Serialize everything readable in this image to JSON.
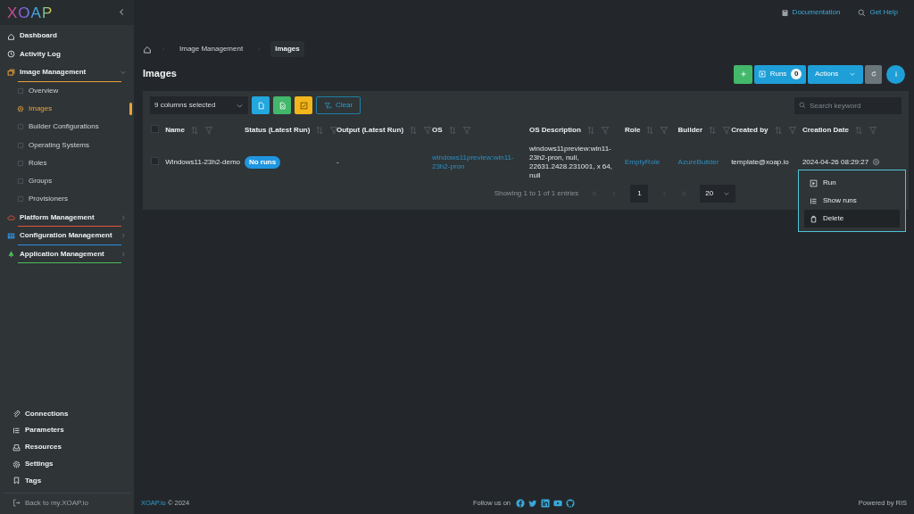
{
  "logo": "XOAP",
  "sidebar": {
    "items": [
      {
        "label": "Dashboard",
        "kind": "link"
      },
      {
        "label": "Activity Log",
        "kind": "link"
      },
      {
        "label": "Image Management",
        "kind": "group",
        "color": "#e8a33c",
        "expanded": true,
        "children": [
          {
            "label": "Overview",
            "selected": false
          },
          {
            "label": "Images",
            "selected": true
          },
          {
            "label": "Builder Configurations",
            "selected": false
          },
          {
            "label": "Operating Systems",
            "selected": false
          },
          {
            "label": "Roles",
            "selected": false
          },
          {
            "label": "Groups",
            "selected": false
          },
          {
            "label": "Provisioners",
            "selected": false
          }
        ]
      },
      {
        "label": "Platform Management",
        "kind": "group",
        "color": "#e0553b",
        "expanded": false
      },
      {
        "label": "Configuration Management",
        "kind": "group",
        "color": "#2f8fe0",
        "expanded": false
      },
      {
        "label": "Application Management",
        "kind": "group",
        "color": "#4cbb5a",
        "expanded": false
      }
    ],
    "bottom_items": [
      "Connections",
      "Parameters",
      "Resources",
      "Settings",
      "Tags"
    ],
    "back_link": "Back to my.XOAP.io"
  },
  "header_links": [
    "Documentation",
    "Get Help"
  ],
  "breadcrumb": [
    {
      "label": "Image Management",
      "selected": false
    },
    {
      "label": "Images",
      "selected": true
    }
  ],
  "page_title": "Images",
  "toolbar": {
    "runs_label": "Runs",
    "runs_count": "0",
    "actions_label": "Actions"
  },
  "table": {
    "columns_select": "9 columns selected",
    "clear_label": "Clear",
    "search_placeholder": "Search keyword",
    "select_all": false,
    "columns": [
      "Name",
      "Status (Latest Run)",
      "Output (Latest Run)",
      "OS",
      "OS Description",
      "Role",
      "Builder",
      "Created by",
      "Creation Date"
    ],
    "rows": [
      {
        "selected": false,
        "name": "Windows11-23h2-demo",
        "status": "No runs",
        "output": "-",
        "os": "windows11preview:win11-23h2-pron",
        "os_description": "windows11preview:win11-23h2-pron, null, 22631.2428.231001, x 64, null",
        "role": "EmptyRole",
        "builder": "AzureBuilder",
        "created_by": "template@xoap.io",
        "creation_date": "2024-04-26 08:29:27"
      }
    ],
    "summary": "Showing 1 to 1 of 1 entries",
    "page": "1",
    "page_size": "20"
  },
  "row_menu": [
    {
      "label": "Run",
      "selected": false
    },
    {
      "label": "Show runs",
      "selected": false
    },
    {
      "label": "Delete",
      "selected": true
    }
  ],
  "footer": {
    "brand": "XOAP.io",
    "copyright": "© 2024",
    "follow": "Follow us on",
    "powered": "Powered by RIS"
  }
}
